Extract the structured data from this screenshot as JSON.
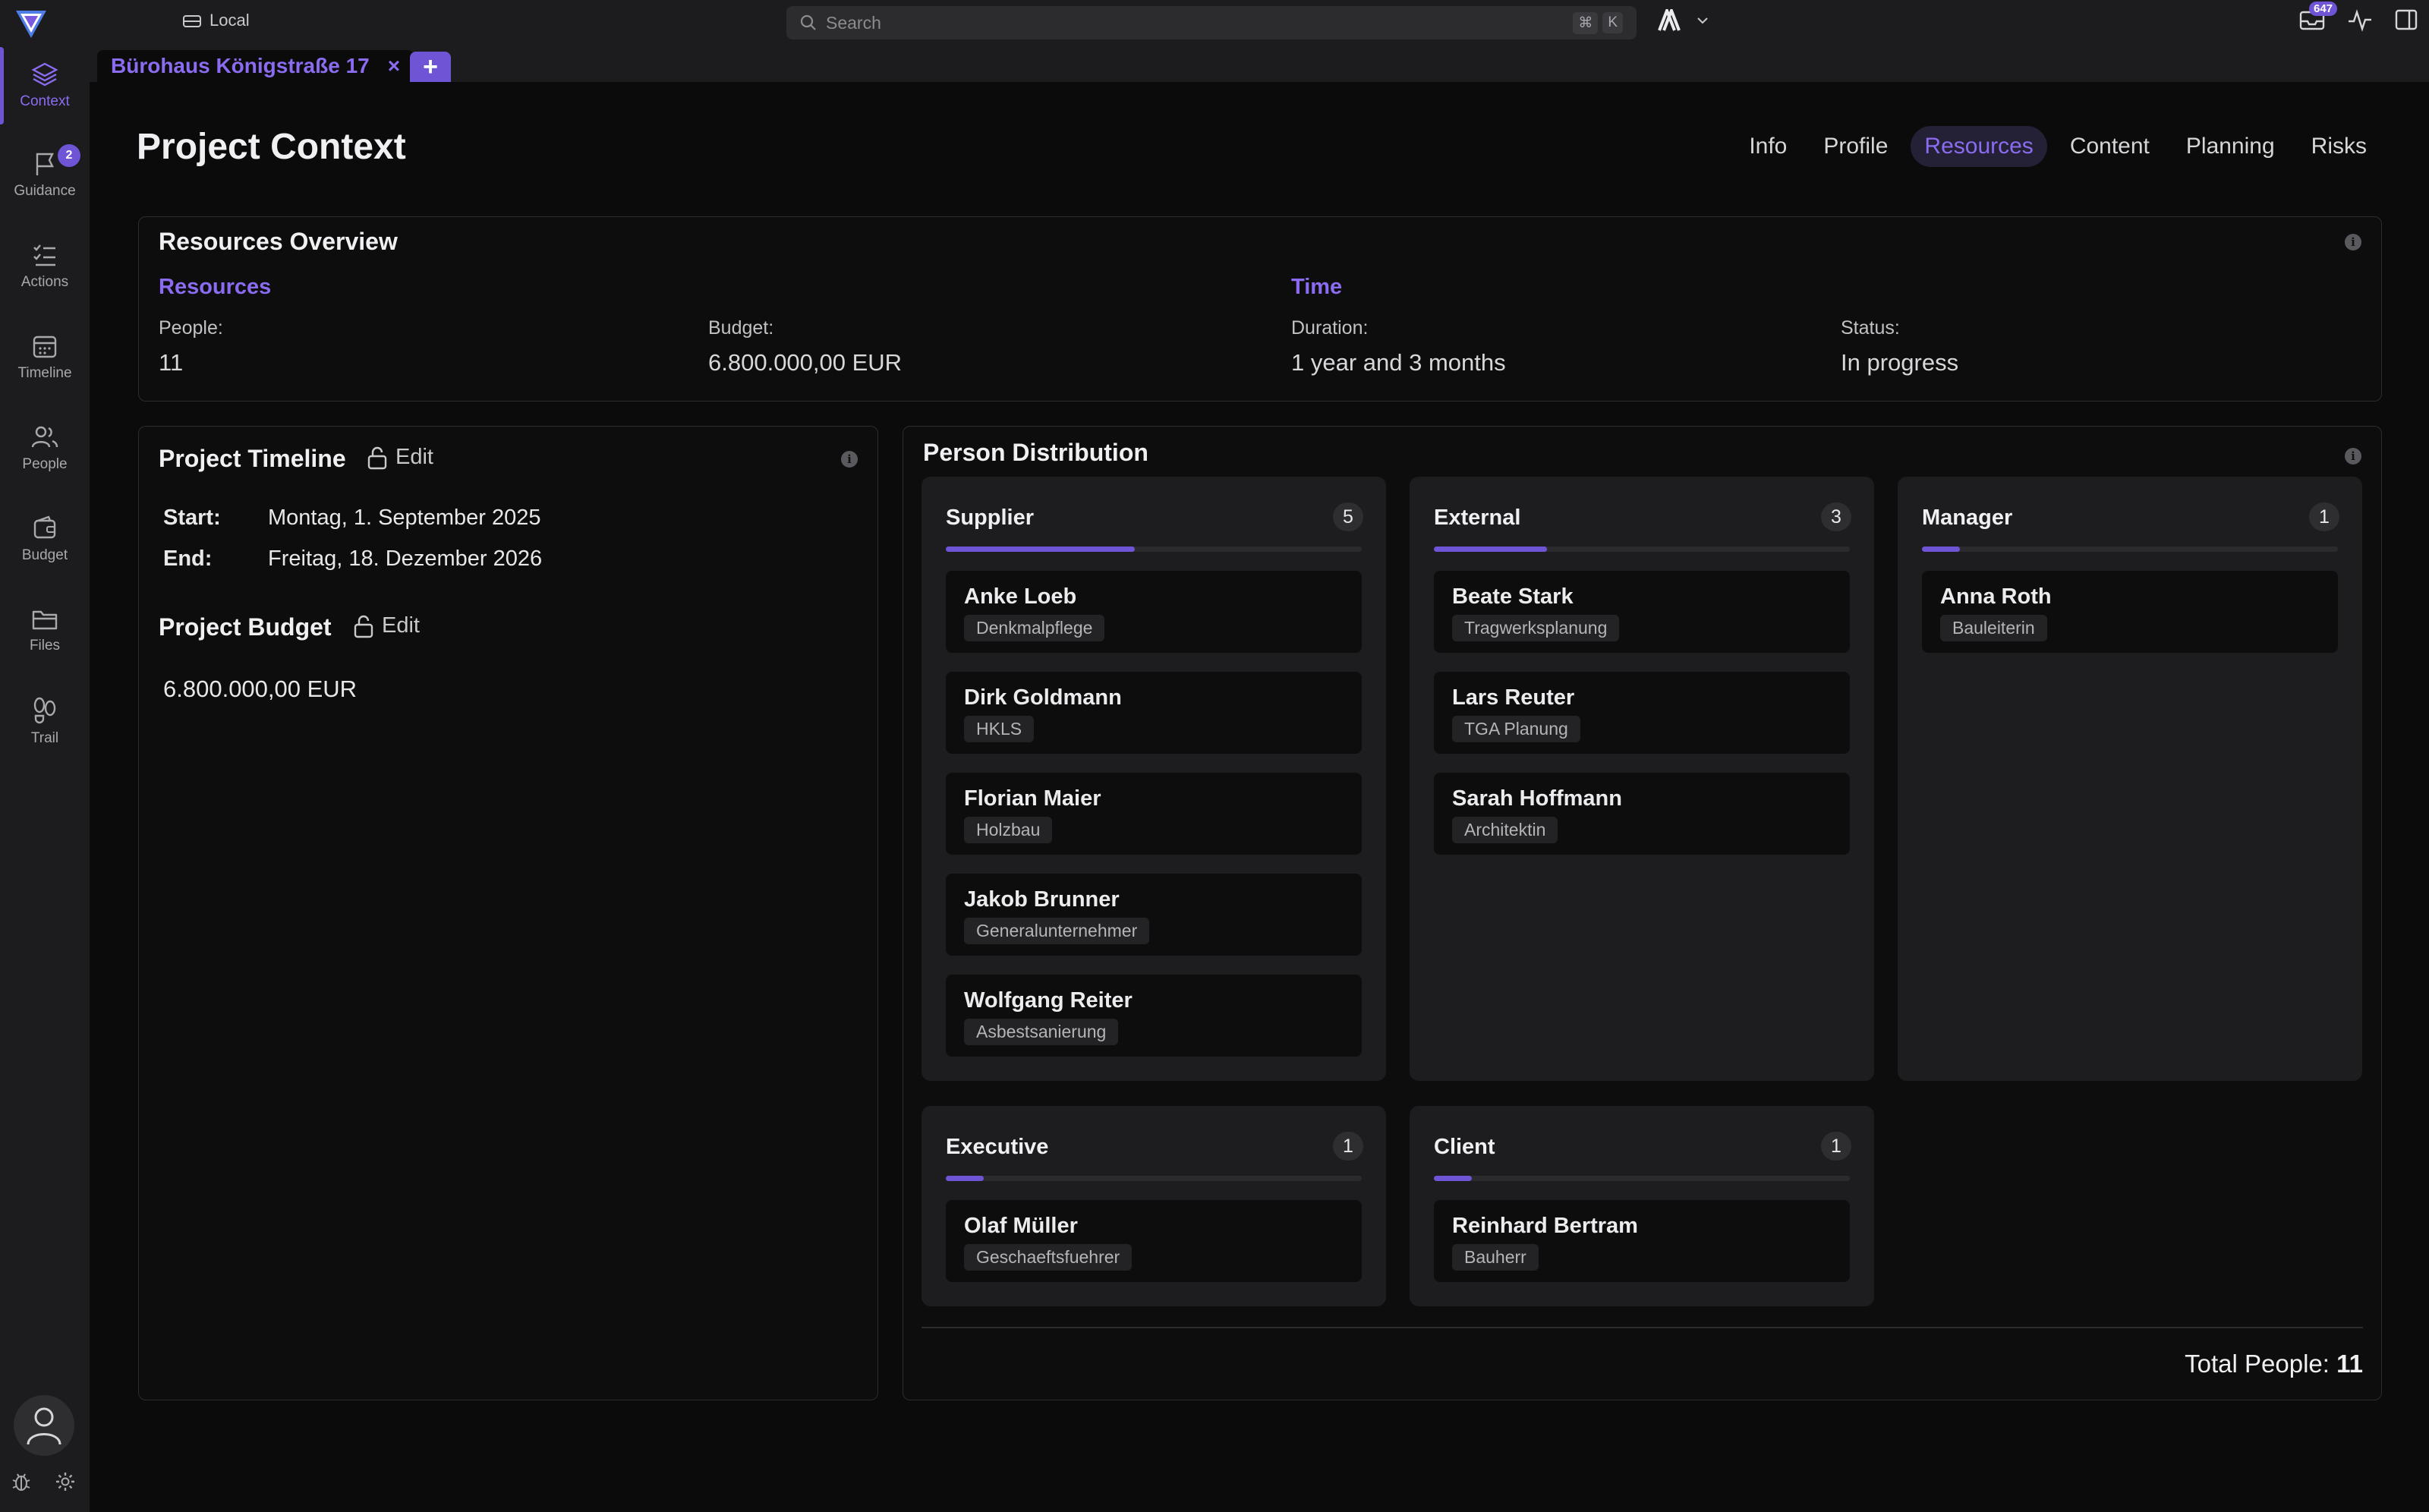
{
  "topbar": {
    "environment": "Local",
    "search_placeholder": "Search",
    "shortcut_modifier": "⌘",
    "shortcut_key": "K",
    "inbox_count": "647"
  },
  "sidebar": {
    "items": [
      {
        "label": "Context",
        "icon": "layers-icon",
        "active": true
      },
      {
        "label": "Guidance",
        "icon": "flag-icon",
        "badge": "2"
      },
      {
        "label": "Actions",
        "icon": "checklist-icon"
      },
      {
        "label": "Timeline",
        "icon": "calendar-icon"
      },
      {
        "label": "People",
        "icon": "people-icon"
      },
      {
        "label": "Budget",
        "icon": "wallet-icon"
      },
      {
        "label": "Files",
        "icon": "folder-icon"
      },
      {
        "label": "Trail",
        "icon": "footprints-icon"
      }
    ]
  },
  "tab": {
    "label": "Bürohaus Königstraße 17",
    "close": "×",
    "add": "+"
  },
  "page": {
    "title": "Project Context",
    "sections": [
      "Info",
      "Profile",
      "Resources",
      "Content",
      "Planning",
      "Risks"
    ],
    "active_section": "Resources"
  },
  "overview": {
    "title": "Resources Overview",
    "resources_heading": "Resources",
    "time_heading": "Time",
    "people_label": "People:",
    "people_value": "11",
    "budget_label": "Budget:",
    "budget_value": "6.800.000,00 EUR",
    "duration_label": "Duration:",
    "duration_value": "1 year and 3 months",
    "status_label": "Status:",
    "status_value": "In progress"
  },
  "timeline": {
    "title": "Project Timeline",
    "edit": "Edit",
    "start_label": "Start:",
    "start_value": "Montag, 1. September 2025",
    "end_label": "End:",
    "end_value": "Freitag, 18. Dezember 2026"
  },
  "budget": {
    "title": "Project Budget",
    "edit": "Edit",
    "value": "6.800.000,00 EUR"
  },
  "distribution": {
    "title": "Person Distribution",
    "total_label": "Total People:",
    "total_value": "11",
    "groups": [
      {
        "name": "Supplier",
        "count": "5",
        "share": 0.4545,
        "people": [
          {
            "name": "Anke Loeb",
            "role": "Denkmalpflege"
          },
          {
            "name": "Dirk Goldmann",
            "role": "HKLS"
          },
          {
            "name": "Florian Maier",
            "role": "Holzbau"
          },
          {
            "name": "Jakob Brunner",
            "role": "Generalunternehmer"
          },
          {
            "name": "Wolfgang Reiter",
            "role": "Asbestsanierung"
          }
        ]
      },
      {
        "name": "External",
        "count": "3",
        "share": 0.2727,
        "people": [
          {
            "name": "Beate Stark",
            "role": "Tragwerksplanung"
          },
          {
            "name": "Lars Reuter",
            "role": "TGA Planung"
          },
          {
            "name": "Sarah Hoffmann",
            "role": "Architektin"
          }
        ]
      },
      {
        "name": "Manager",
        "count": "1",
        "share": 0.0909,
        "people": [
          {
            "name": "Anna Roth",
            "role": "Bauleiterin"
          }
        ]
      },
      {
        "name": "Executive",
        "count": "1",
        "share": 0.0909,
        "people": [
          {
            "name": "Olaf Müller",
            "role": "Geschaeftsfuehrer"
          }
        ]
      },
      {
        "name": "Client",
        "count": "1",
        "share": 0.0909,
        "people": [
          {
            "name": "Reinhard Bertram",
            "role": "Bauherr"
          }
        ]
      }
    ]
  },
  "colors": {
    "accent": "#6f54d6",
    "accent_text": "#8b6cf0",
    "background": "#0b0b0c"
  }
}
